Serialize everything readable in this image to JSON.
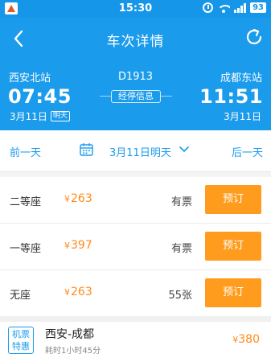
{
  "status_bar": {
    "time": "15:30",
    "battery": "93"
  },
  "nav": {
    "title": "车次详情"
  },
  "train": {
    "number": "D1913",
    "stops_label": "经停信息",
    "departure": {
      "station": "西安北站",
      "time": "07:45",
      "date": "3月11日",
      "day_tag": "明天"
    },
    "arrival": {
      "station": "成都东站",
      "time": "11:51",
      "date": "3月11日"
    }
  },
  "date_selector": {
    "prev_label": "前一天",
    "current": "3月11日明天",
    "next_label": "后一天"
  },
  "seats": [
    {
      "name": "二等座",
      "currency": "¥",
      "price": "263",
      "stock": "有票",
      "action": "预订"
    },
    {
      "name": "一等座",
      "currency": "¥",
      "price": "397",
      "stock": "有票",
      "action": "预订"
    },
    {
      "name": "无座",
      "currency": "¥",
      "price": "263",
      "stock": "55张",
      "action": "预订"
    }
  ],
  "promo": {
    "badge_line1": "机票",
    "badge_line2": "特惠",
    "route": "西安-成都",
    "duration": "耗时1小时45分",
    "currency": "¥",
    "price": "380"
  },
  "colors": {
    "primary": "#1a9bec",
    "accent": "#ff9c1e",
    "price": "#ff8a1a"
  },
  "icons": [
    "back-icon",
    "refresh-icon",
    "calendar-icon",
    "chevron-down-icon",
    "alarm-icon",
    "wifi-icon",
    "signal-icon",
    "battery-icon"
  ]
}
